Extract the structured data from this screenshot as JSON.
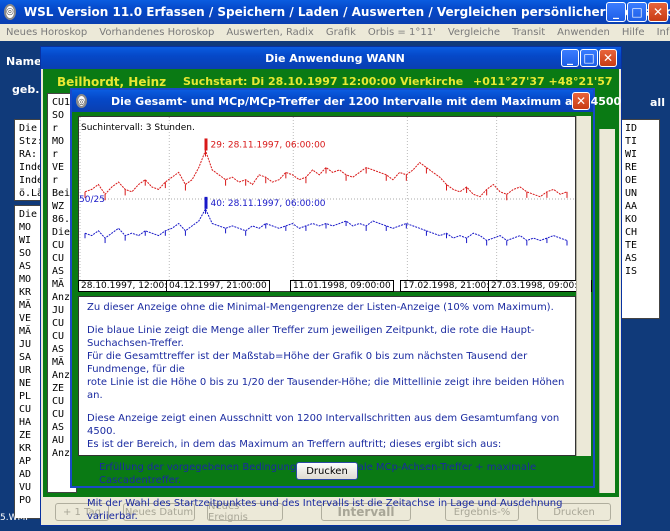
{
  "app": {
    "title": "WSL Version 11.0     Erfassen / Speichern / Laden / Auswerten / Vergleichen persönlicher Horoskope",
    "menu": [
      "Neues Horoskop",
      "Vorhandenes Horoskop",
      "Auswerten, Radix",
      "Grafik",
      "Orbis = 1°11'",
      "Vergleiche",
      "Transit",
      "Anwenden",
      "Hilfe",
      "Info"
    ]
  },
  "background": {
    "name_label": "Name",
    "geb_label": "geb.",
    "all_label": "all",
    "left_top_lines": [
      "Die ",
      "Stz:",
      "RA: ",
      "Inde",
      "Inde",
      "ö.Lä"
    ],
    "left_list_lines": [
      "Die ",
      " MO",
      " WI",
      " SO",
      " AS",
      " MO",
      " KR",
      " MÄ",
      " VE",
      " MÄ",
      " JU",
      " SA",
      " UR",
      " NE",
      " PL",
      " CU",
      " HA",
      " ZE",
      " KR",
      " AP",
      " AD",
      " VU",
      " PO"
    ],
    "right_lines": [
      "ID",
      "TI",
      "WI",
      "RE",
      "OE",
      "UN",
      "AA",
      "KO",
      "CH",
      "TE",
      "AS",
      "IS"
    ],
    "wmf_label": "5.WMF"
  },
  "wann": {
    "title": "Die Anwendung WANN",
    "header_name": "Beilhordt, Heinz",
    "header_suchstart": "Suchstart: Di 28.10.1997   12:00:00   Vierkirche",
    "header_coords": "+011°27'37 +48°21'57",
    "list_lines": [
      "CU1",
      "SO r",
      "MO r",
      "VE r",
      "",
      "Beid",
      "",
      "WZ",
      "86.",
      "Die"
    ],
    "list_lines2": [
      "CU",
      "CU",
      "AS",
      "MÄ",
      "Anz",
      "",
      "JU",
      "CU",
      "CU",
      "AS",
      "MÄ",
      "Anz",
      "",
      "ZE",
      "CU",
      "CU",
      "AS",
      "AU",
      "Anz"
    ],
    "buttons": {
      "plus_tag": "+ 1 Tag",
      "neues_datum": "Neues Datum",
      "neues_ereignis": "Neues Ereignis",
      "intervall": "Intervall",
      "ergebnis": "Ergebnis-%",
      "drucken": "Drucken"
    }
  },
  "dialog": {
    "title": "Die Gesamt- und MCp/MCp-Treffer der 1200 Intervalle mit dem Maximum aus 4500",
    "suchintervall": "Suchintervall: 3 Stunden.",
    "x_labels": [
      "28.10.1997, 12:00:00",
      "04.12.1997, 21:00:00",
      "11.01.1998, 09:00:00",
      "17.02.1998, 21:00:00",
      "27.03.1998, 09:00:00"
    ],
    "info_lines": [
      "Zu dieser Anzeige ohne die Minimal-Mengengrenze der Listen-Anzeige (10% vom Maximum).",
      "Die blaue Linie zeigt die Menge aller Treffer zum jeweiligen Zeitpunkt, die rote die Haupt-Suchachsen-Treffer.",
      "Für die Gesamttreffer ist der Maßstab=Höhe der Grafik 0 bis zum nächsten Tausend der Fundmenge, für die",
      "rote Linie ist die Höhe 0 bis zu  1/20  der Tausender-Höhe; die Mittellinie zeigt ihre beiden Höhen an.",
      "Diese Anzeige zeigt einen Ausschnitt von 1200 Intervallschritten aus dem Gesamtumfang von 4500.",
      "Es ist der Bereich, in dem das Maximum an Treffern auftritt; dieses ergibt sich aus:",
      "Erfüllung der vorgegebenen Bedingungen + maximale MCp-Achsen-Treffer + maximale Cascadentreffer.",
      "Mit der Wahl des Startzeitpunktes und des Intervalls ist die Zeitachse in Lage und Ausdehnung variierbar."
    ],
    "print_button": "Drucken"
  },
  "chart_data": {
    "type": "line",
    "title": "Suchintervall: 3 Stunden.",
    "x_tick_labels": [
      "28.10.1997, 12:00:00",
      "04.12.1997, 21:00:00",
      "11.01.1998, 09:00:00",
      "17.02.1998, 21:00:00",
      "27.03.1998, 09:00:00"
    ],
    "mid_label": "50/25",
    "colors": {
      "red": "#d81818",
      "blue": "#1818c8"
    },
    "series": [
      {
        "color": "red",
        "annotation": "29:  28.11.1997, 06:00:00",
        "values": [
          35,
          36,
          38,
          34,
          37,
          39,
          36,
          35,
          38,
          40,
          37,
          36,
          39,
          41,
          43,
          38,
          40,
          45,
          52,
          44,
          42,
          40,
          41,
          39,
          40,
          38,
          42,
          41,
          39,
          40,
          43,
          42,
          40,
          41,
          44,
          42,
          45,
          43,
          44,
          42,
          41,
          43,
          45,
          44,
          43,
          42,
          40,
          43,
          42,
          44,
          47,
          45,
          43,
          41,
          38,
          36,
          35,
          37,
          34,
          33,
          36,
          38,
          35,
          34,
          36,
          37,
          35,
          34,
          33,
          35,
          36,
          34,
          35
        ]
      },
      {
        "color": "blue",
        "annotation": "40:  28.11.1997, 06:00:00",
        "values": [
          18,
          17,
          19,
          16,
          18,
          20,
          17,
          18,
          17,
          19,
          18,
          17,
          19,
          20,
          22,
          19,
          21,
          23,
          28,
          22,
          21,
          20,
          21,
          20,
          19,
          21,
          20,
          22,
          21,
          20,
          21,
          22,
          20,
          21,
          22,
          21,
          22,
          21,
          22,
          23,
          21,
          22,
          21,
          23,
          22,
          21,
          20,
          21,
          22,
          21,
          20,
          19,
          18,
          17,
          18,
          16,
          17,
          16,
          18,
          17,
          15,
          16,
          17,
          15,
          16,
          17,
          15,
          16,
          15,
          16,
          17,
          16,
          15
        ]
      }
    ]
  }
}
